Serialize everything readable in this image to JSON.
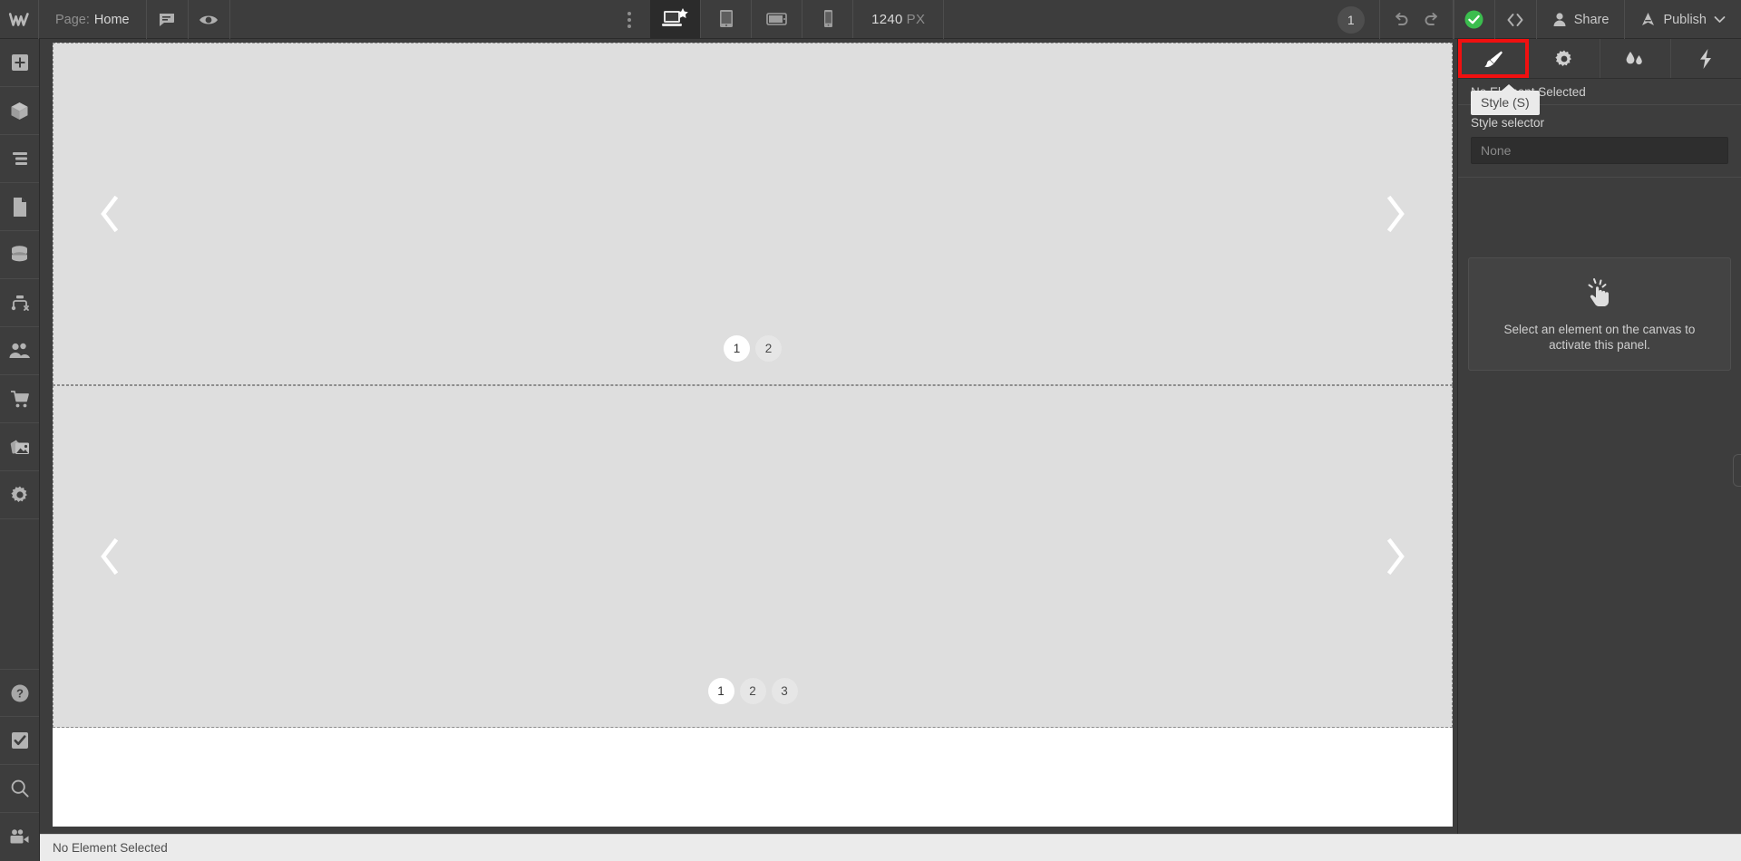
{
  "app": {
    "name": "Webflow Designer",
    "logo_icon": "webflow-logo-icon"
  },
  "topbar": {
    "page_label": "Page:",
    "page_name": "Home",
    "comments_icon": "comment-bubble-icon",
    "preview_icon": "eye-icon",
    "more_icon": "vertical-dots-icon",
    "viewports": [
      {
        "name": "desktop-base",
        "icon": "desktop-star-icon",
        "active": true
      },
      {
        "name": "tablet",
        "icon": "tablet-icon",
        "active": false
      },
      {
        "name": "mobile-landscape",
        "icon": "mobile-landscape-icon",
        "active": false
      },
      {
        "name": "mobile-portrait",
        "icon": "mobile-portrait-icon",
        "active": false
      }
    ],
    "canvas_width": "1240",
    "canvas_unit": "PX",
    "step_badge": "1",
    "undo_icon": "undo-arrow-icon",
    "redo_icon": "redo-arrow-icon",
    "sync_icon": "check-circle-icon",
    "sync_color": "#3bbd4e",
    "code_icon": "code-brackets-icon",
    "share_label": "Share",
    "share_icon": "person-icon",
    "publish_label": "Publish",
    "publish_icon": "rocket-icon",
    "publish_caret_icon": "chevron-down-icon"
  },
  "left_sidebar": {
    "items": [
      {
        "name": "add-elements",
        "icon": "plus-square-icon"
      },
      {
        "name": "components",
        "icon": "cube-icon"
      },
      {
        "name": "navigator",
        "icon": "layers-lines-icon"
      },
      {
        "name": "pages",
        "icon": "page-document-icon"
      },
      {
        "name": "cms-collections",
        "icon": "database-icon"
      },
      {
        "name": "logic-flows",
        "icon": "logic-node-icon"
      },
      {
        "name": "users",
        "icon": "people-icon"
      },
      {
        "name": "ecommerce",
        "icon": "shopping-cart-icon"
      },
      {
        "name": "assets",
        "icon": "images-stack-icon"
      },
      {
        "name": "settings",
        "icon": "gear-icon"
      }
    ],
    "bottom_items": [
      {
        "name": "help",
        "icon": "question-circle-icon"
      },
      {
        "name": "audit",
        "icon": "checkbox-check-icon"
      },
      {
        "name": "search",
        "icon": "magnifier-icon"
      },
      {
        "name": "video-tutorials",
        "icon": "video-camera-icon"
      }
    ]
  },
  "canvas": {
    "sections": [
      {
        "name": "slider-section-top",
        "prev_icon": "chevron-left-icon",
        "next_icon": "chevron-right-icon",
        "dots": [
          {
            "label": "1",
            "active": true
          },
          {
            "label": "2",
            "active": false
          }
        ]
      },
      {
        "name": "slider-section-bottom",
        "prev_icon": "chevron-left-icon",
        "next_icon": "chevron-right-icon",
        "dots": [
          {
            "label": "1",
            "active": true
          },
          {
            "label": "2",
            "active": false
          },
          {
            "label": "3",
            "active": false
          }
        ]
      }
    ]
  },
  "right_panel": {
    "tabs": [
      {
        "name": "style",
        "icon": "paintbrush-icon",
        "highlighted": true
      },
      {
        "name": "settings",
        "icon": "gear-icon",
        "highlighted": false
      },
      {
        "name": "interactions",
        "icon": "droplets-icon",
        "highlighted": false
      },
      {
        "name": "effects",
        "icon": "lightning-bolt-icon",
        "highlighted": false
      }
    ],
    "header_text": "No Element Selected",
    "style_selector_label": "Style selector",
    "style_selector_placeholder": "None",
    "empty_state": {
      "icon": "pointing-hand-icon",
      "text": "Select an element on the canvas to activate this panel."
    }
  },
  "tooltip": {
    "text": "Style (S)"
  },
  "statusbar": {
    "text": "No Element Selected"
  },
  "colors": {
    "chrome": "#3d3d3d",
    "chrome_dark": "#2b2b2b",
    "canvas_section": "#dedede",
    "accent_green": "#3bbd4e",
    "highlight_red": "#f11010",
    "panel_input": "#2e2e2e"
  }
}
